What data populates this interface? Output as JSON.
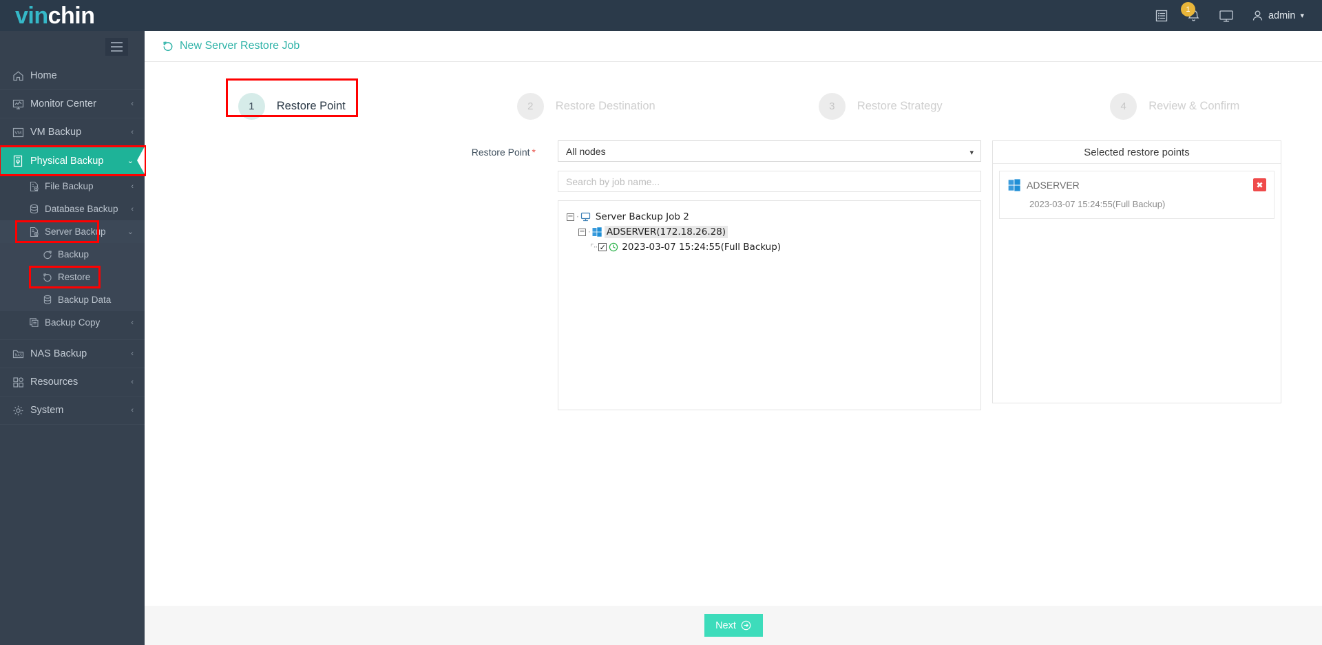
{
  "brand": {
    "part1": "vin",
    "part2": "chin"
  },
  "topbar": {
    "icons": [
      {
        "name": "list-icon"
      },
      {
        "name": "bell-icon",
        "badge": "1"
      },
      {
        "name": "monitor-icon"
      }
    ],
    "user": "admin"
  },
  "sidebar": {
    "collapse_label": "collapse-menu",
    "items": [
      {
        "label": "Home",
        "icon": "home-icon",
        "chevron": ""
      },
      {
        "label": "Monitor Center",
        "icon": "monitor-chart-icon",
        "chevron": "‹"
      },
      {
        "label": "VM Backup",
        "icon": "vm-icon",
        "chevron": "‹"
      },
      {
        "label": "Physical Backup",
        "icon": "physical-backup-icon",
        "chevron": "⌄",
        "active": true
      },
      {
        "label": "NAS Backup",
        "icon": "nas-icon",
        "chevron": "‹"
      },
      {
        "label": "Resources",
        "icon": "resources-icon",
        "chevron": "‹"
      },
      {
        "label": "System",
        "icon": "gear-icon",
        "chevron": "‹"
      }
    ],
    "physical_children": [
      {
        "label": "File Backup",
        "icon": "file-backup-icon",
        "chevron": "‹"
      },
      {
        "label": "Database Backup",
        "icon": "database-icon",
        "chevron": "‹"
      },
      {
        "label": "Server Backup",
        "icon": "server-backup-icon",
        "chevron": "⌄",
        "highlighted": true
      },
      {
        "label": "Backup Copy",
        "icon": "copy-icon",
        "chevron": "‹"
      }
    ],
    "server_backup_children": [
      {
        "label": "Backup",
        "icon": "refresh-cw-icon"
      },
      {
        "label": "Restore",
        "icon": "restore-ccw-icon",
        "highlighted": true
      },
      {
        "label": "Backup Data",
        "icon": "database-icon"
      }
    ]
  },
  "page": {
    "title": "New Server Restore Job",
    "title_icon": "restore-ccw-icon"
  },
  "stepper": {
    "steps": [
      {
        "num": "1",
        "label": "Restore Point",
        "state": "done",
        "highlighted": true
      },
      {
        "num": "2",
        "label": "Restore Destination",
        "state": "todo"
      },
      {
        "num": "3",
        "label": "Restore Strategy",
        "state": "todo"
      },
      {
        "num": "4",
        "label": "Review & Confirm",
        "state": "todo"
      }
    ]
  },
  "form": {
    "label": "Restore Point",
    "required_mark": "*",
    "select_value": "All nodes",
    "select_options": [
      "All nodes"
    ],
    "search_placeholder": "Search by job name..."
  },
  "tree": {
    "nodes": [
      {
        "level": 1,
        "toggle": "−",
        "icon": "monitor-icon",
        "label": "Server Backup Job 2",
        "selected": false,
        "checkbox": null
      },
      {
        "level": 2,
        "toggle": "−",
        "icon": "windows-icon",
        "label": "ADSERVER(172.18.26.28)",
        "selected": true,
        "checkbox": null
      },
      {
        "level": 3,
        "toggle": null,
        "icon": "clock-icon",
        "label": "2023-03-07 15:24:55(Full  Backup)",
        "selected": false,
        "checkbox": "✓"
      }
    ]
  },
  "selected_panel": {
    "title": "Selected restore points",
    "cards": [
      {
        "icon": "windows-icon",
        "name": "ADSERVER",
        "date": "2023-03-07 15:24:55(Full Backup)",
        "delete_label": "✖"
      }
    ]
  },
  "footer": {
    "next_label": "Next",
    "next_icon": "arrow-right-circle-icon"
  },
  "colors": {
    "brand_teal": "#35b8c8",
    "accent_green": "#1eb398",
    "button_green": "#3ddcbb",
    "title_teal": "#2fb3a8",
    "highlight_red": "#ff0000",
    "badge_yellow": "#e8b53a",
    "delete_red": "#ef4b4b",
    "sidebar_bg": "#36414f",
    "topbar_bg": "#2b3a4a"
  }
}
